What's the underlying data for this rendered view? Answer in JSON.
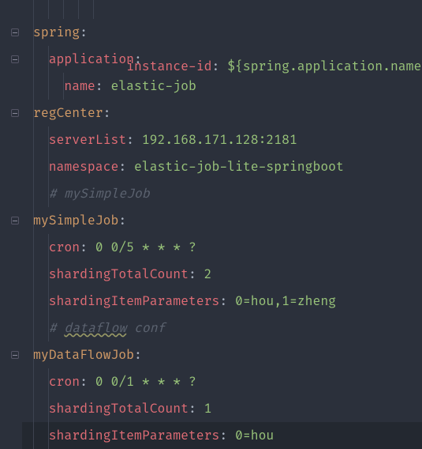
{
  "partial_top": {
    "key": "instance-id",
    "value": "${spring.application.name}"
  },
  "lines": [
    {
      "kind": "key0",
      "key": "spring",
      "fold": true
    },
    {
      "kind": "key1",
      "key": "application",
      "fold": true
    },
    {
      "kind": "kv2",
      "key": "name",
      "val": "elastic-job"
    },
    {
      "kind": "key0",
      "key": "regCenter",
      "fold": true
    },
    {
      "kind": "kv1",
      "key": "serverList",
      "val": "192.168.171.128:2181"
    },
    {
      "kind": "kv1",
      "key": "namespace",
      "val": "elastic-job-lite-springboot"
    },
    {
      "kind": "comment",
      "text": "# mySimpleJob"
    },
    {
      "kind": "key0",
      "key": "mySimpleJob",
      "fold": true
    },
    {
      "kind": "kv1",
      "key": "cron",
      "val": "0 0/5 * * * ?"
    },
    {
      "kind": "kv1",
      "key": "shardingTotalCount",
      "val": "2"
    },
    {
      "kind": "kv1",
      "key": "shardingItemParameters",
      "val": "0=hou,1=zheng"
    },
    {
      "kind": "comment2",
      "pre": "# ",
      "u": "dataflow",
      "post": " conf"
    },
    {
      "kind": "key0",
      "key": "myDataFlowJob",
      "fold": true
    },
    {
      "kind": "kv1",
      "key": "cron",
      "val": "0 0/1 * * * ?"
    },
    {
      "kind": "kv1",
      "key": "shardingTotalCount",
      "val": "1"
    },
    {
      "kind": "kv1hl",
      "key": "shardingItemParameters",
      "val": "0=hou"
    }
  ]
}
